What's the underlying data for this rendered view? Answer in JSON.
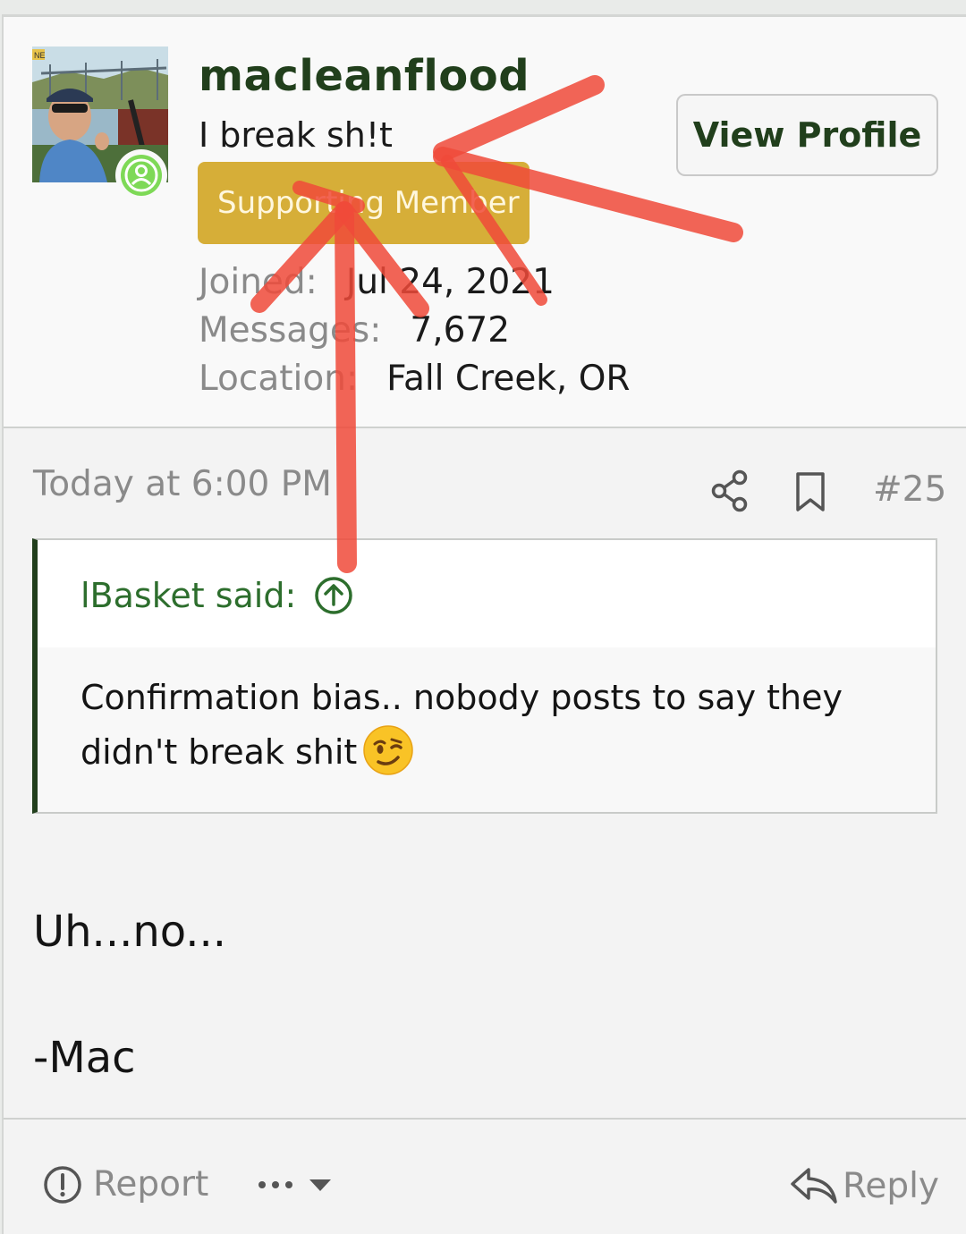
{
  "user": {
    "username": "macleanflood",
    "user_title": "I break sh!t",
    "badge": "Supporting Member",
    "stats": [
      {
        "label": "Joined:",
        "value": "Jul 24, 2021"
      },
      {
        "label": "Messages:",
        "value": "7,672"
      },
      {
        "label": "Location:",
        "value": "Fall Creek, OR"
      }
    ],
    "view_profile_label": "View Profile",
    "avatar_sign_text": "NE"
  },
  "post": {
    "time": "Today at 6:00 PM",
    "number": "#25",
    "quote": {
      "author": "lBasket said:",
      "text": "Confirmation bias.. nobody posts to say they didn't break shit"
    },
    "body_line1": "Uh...no...",
    "body_line2": "-Mac"
  },
  "footer": {
    "report_label": "Report",
    "reply_label": "Reply"
  },
  "icons": {
    "share": "share-icon",
    "bookmark": "bookmark-icon",
    "quote_jump": "arrow-up-circle-icon",
    "report": "exclamation-circle-icon",
    "more": "ellipsis-icon",
    "caret": "caret-down-icon",
    "reply": "reply-arrow-icon",
    "online": "user-online-icon",
    "emoji": "winking-face-icon"
  },
  "colors": {
    "username": "#213f1c",
    "badge_bg": "#d6ae38",
    "quote_author": "#2d6e2d",
    "muted_text": "#8a8a8a",
    "annotation": "#f04a3a"
  }
}
